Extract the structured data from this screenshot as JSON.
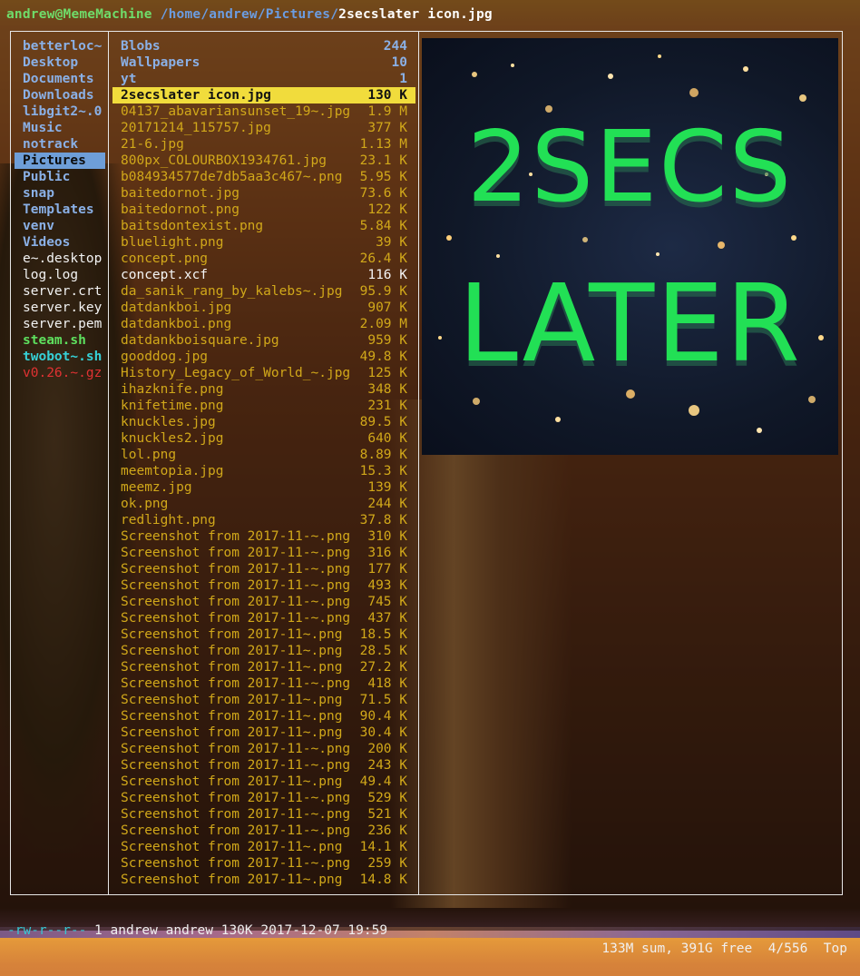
{
  "title": {
    "user_host": "andrew@MemeMachine",
    "path": "/home/andrew/Pictures/",
    "file": "2secslater icon.jpg"
  },
  "parent_entries": [
    {
      "name": "betterloc~",
      "style": "dir"
    },
    {
      "name": "Desktop",
      "style": "dir"
    },
    {
      "name": "Documents",
      "style": "dir"
    },
    {
      "name": "Downloads",
      "style": "dir"
    },
    {
      "name": "libgit2~.0",
      "style": "dir"
    },
    {
      "name": "Music",
      "style": "dir"
    },
    {
      "name": "notrack",
      "style": "dir"
    },
    {
      "name": "Pictures",
      "style": "dirsel"
    },
    {
      "name": "Public",
      "style": "dir"
    },
    {
      "name": "snap",
      "style": "dir"
    },
    {
      "name": "Templates",
      "style": "dir"
    },
    {
      "name": "venv",
      "style": "dir"
    },
    {
      "name": "Videos",
      "style": "dir"
    },
    {
      "name": "e~.desktop",
      "style": "plain"
    },
    {
      "name": "log.log",
      "style": "plain"
    },
    {
      "name": "server.crt",
      "style": "plain"
    },
    {
      "name": "server.key",
      "style": "plain"
    },
    {
      "name": "server.pem",
      "style": "plain"
    },
    {
      "name": "steam.sh",
      "style": "exec"
    },
    {
      "name": "twobot~.sh",
      "style": "link"
    },
    {
      "name": "v0.26.~.gz",
      "style": "arch"
    }
  ],
  "entries": [
    {
      "name": "Blobs",
      "size": "244",
      "style": "dir"
    },
    {
      "name": "Wallpapers",
      "size": "10",
      "style": "dir"
    },
    {
      "name": "yt",
      "size": "1",
      "style": "dir"
    },
    {
      "name": "2secslater icon.jpg",
      "size": "130 K",
      "style": "sel"
    },
    {
      "name": "04137_abavariansunset_19~.jpg",
      "size": "1.9 M",
      "style": "img"
    },
    {
      "name": "20171214_115757.jpg",
      "size": "377 K",
      "style": "img"
    },
    {
      "name": "21-6.jpg",
      "size": "1.13 M",
      "style": "img"
    },
    {
      "name": "800px_COLOURBOX1934761.jpg",
      "size": "23.1 K",
      "style": "img"
    },
    {
      "name": "b084934577de7db5aa3c467~.png",
      "size": "5.95 K",
      "style": "img"
    },
    {
      "name": "baitedornot.jpg",
      "size": "73.6 K",
      "style": "img"
    },
    {
      "name": "baitedornot.png",
      "size": "122 K",
      "style": "img"
    },
    {
      "name": "baitsdontexist.png",
      "size": "5.84 K",
      "style": "img"
    },
    {
      "name": "bluelight.png",
      "size": "39 K",
      "style": "img"
    },
    {
      "name": "concept.png",
      "size": "26.4 K",
      "style": "img"
    },
    {
      "name": "concept.xcf",
      "size": "116 K",
      "style": "plainfile"
    },
    {
      "name": "da_sanik_rang_by_kalebs~.jpg",
      "size": "95.9 K",
      "style": "img"
    },
    {
      "name": "datdankboi.jpg",
      "size": "907 K",
      "style": "img"
    },
    {
      "name": "datdankboi.png",
      "size": "2.09 M",
      "style": "img"
    },
    {
      "name": "datdankboisquare.jpg",
      "size": "959 K",
      "style": "img"
    },
    {
      "name": "gooddog.jpg",
      "size": "49.8 K",
      "style": "img"
    },
    {
      "name": "History_Legacy_of_World_~.jpg",
      "size": "125 K",
      "style": "img"
    },
    {
      "name": "ihazknife.png",
      "size": "348 K",
      "style": "img"
    },
    {
      "name": "knifetime.png",
      "size": "231 K",
      "style": "img"
    },
    {
      "name": "knuckles.jpg",
      "size": "89.5 K",
      "style": "img"
    },
    {
      "name": "knuckles2.jpg",
      "size": "640 K",
      "style": "img"
    },
    {
      "name": "lol.png",
      "size": "8.89 K",
      "style": "img"
    },
    {
      "name": "meemtopia.jpg",
      "size": "15.3 K",
      "style": "img"
    },
    {
      "name": "meemz.jpg",
      "size": "139 K",
      "style": "img"
    },
    {
      "name": "ok.png",
      "size": "244 K",
      "style": "img"
    },
    {
      "name": "redlight.png",
      "size": "37.8 K",
      "style": "img"
    },
    {
      "name": "Screenshot from 2017-11-~.png",
      "size": "310 K",
      "style": "img"
    },
    {
      "name": "Screenshot from 2017-11-~.png",
      "size": "316 K",
      "style": "img"
    },
    {
      "name": "Screenshot from 2017-11-~.png",
      "size": "177 K",
      "style": "img"
    },
    {
      "name": "Screenshot from 2017-11-~.png",
      "size": "493 K",
      "style": "img"
    },
    {
      "name": "Screenshot from 2017-11-~.png",
      "size": "745 K",
      "style": "img"
    },
    {
      "name": "Screenshot from 2017-11-~.png",
      "size": "437 K",
      "style": "img"
    },
    {
      "name": "Screenshot from 2017-11~.png",
      "size": "18.5 K",
      "style": "img"
    },
    {
      "name": "Screenshot from 2017-11~.png",
      "size": "28.5 K",
      "style": "img"
    },
    {
      "name": "Screenshot from 2017-11~.png",
      "size": "27.2 K",
      "style": "img"
    },
    {
      "name": "Screenshot from 2017-11-~.png",
      "size": "418 K",
      "style": "img"
    },
    {
      "name": "Screenshot from 2017-11~.png",
      "size": "71.5 K",
      "style": "img"
    },
    {
      "name": "Screenshot from 2017-11~.png",
      "size": "90.4 K",
      "style": "img"
    },
    {
      "name": "Screenshot from 2017-11~.png",
      "size": "30.4 K",
      "style": "img"
    },
    {
      "name": "Screenshot from 2017-11-~.png",
      "size": "200 K",
      "style": "img"
    },
    {
      "name": "Screenshot from 2017-11-~.png",
      "size": "243 K",
      "style": "img"
    },
    {
      "name": "Screenshot from 2017-11~.png",
      "size": "49.4 K",
      "style": "img"
    },
    {
      "name": "Screenshot from 2017-11-~.png",
      "size": "529 K",
      "style": "img"
    },
    {
      "name": "Screenshot from 2017-11-~.png",
      "size": "521 K",
      "style": "img"
    },
    {
      "name": "Screenshot from 2017-11-~.png",
      "size": "236 K",
      "style": "img"
    },
    {
      "name": "Screenshot from 2017-11~.png",
      "size": "14.1 K",
      "style": "img"
    },
    {
      "name": "Screenshot from 2017-11-~.png",
      "size": "259 K",
      "style": "img"
    },
    {
      "name": "Screenshot from 2017-11~.png",
      "size": "14.8 K",
      "style": "img"
    }
  ],
  "preview": {
    "line1": "2SECS",
    "line2": "LATER"
  },
  "status": {
    "perms": "-rw-r--r--",
    "info": "1 andrew andrew 130K 2017-12-07 19:59",
    "summary": "133M sum, 391G free  4/556  Top"
  },
  "colors": {
    "dir": "#8ab0e6",
    "image_file": "#d1a81a",
    "selection": "#f1dc3c",
    "exec": "#5ee05e",
    "link": "#36d0d6",
    "archive": "#e03232"
  }
}
